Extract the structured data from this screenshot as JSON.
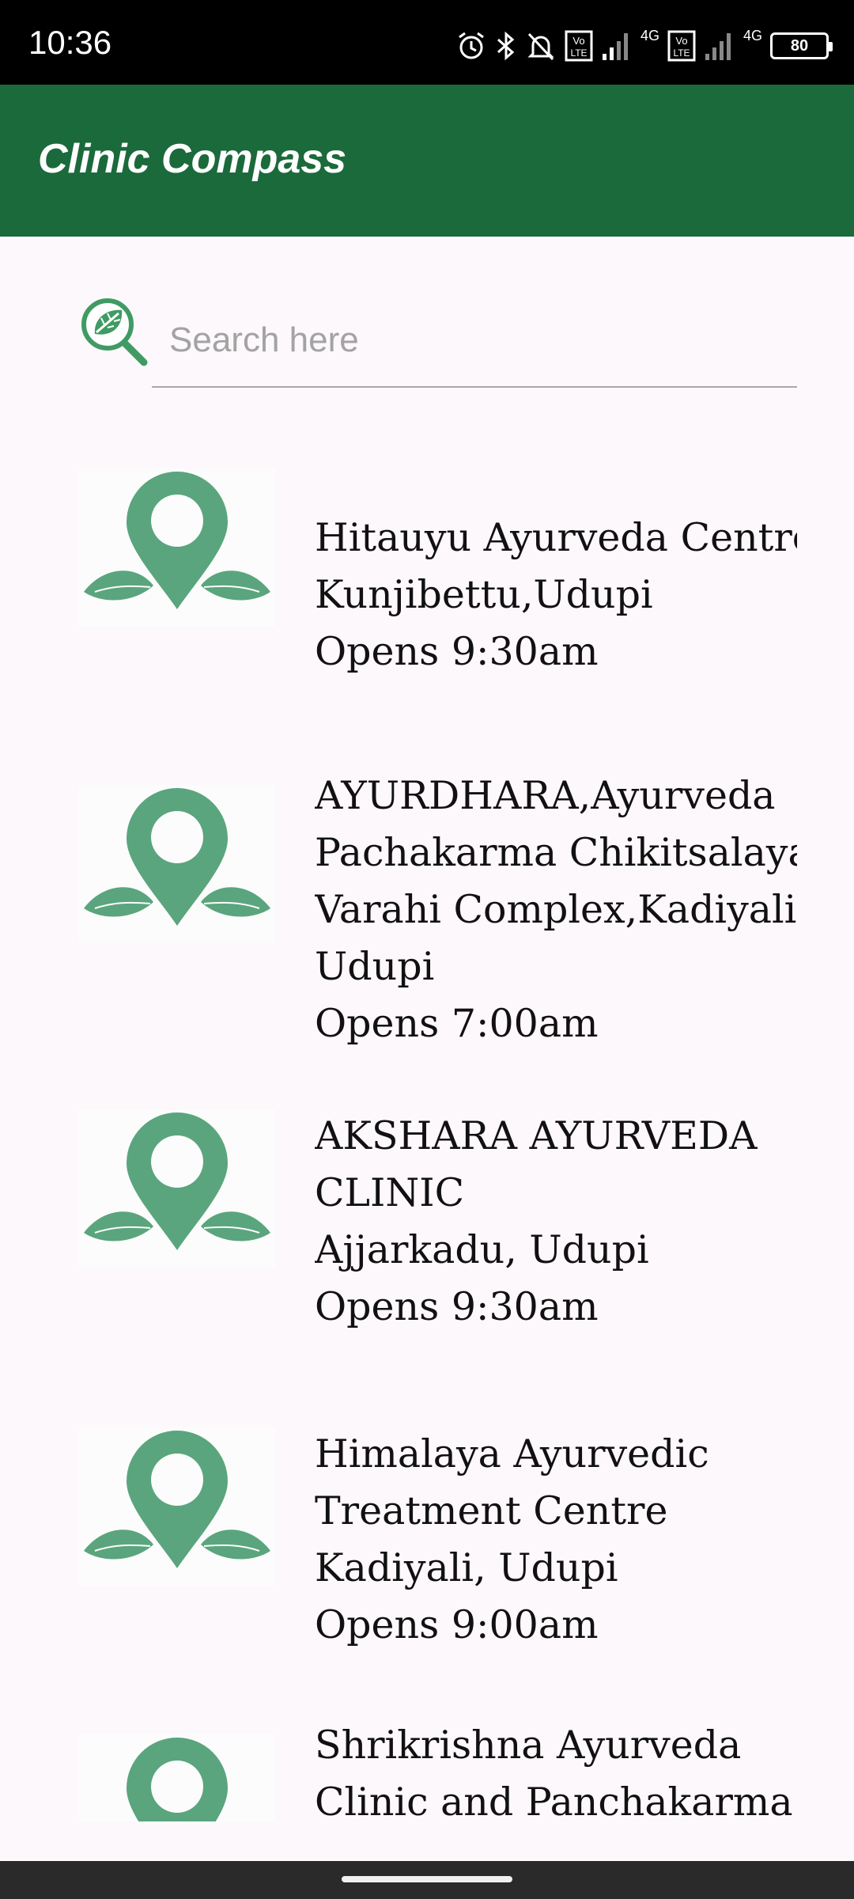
{
  "status_bar": {
    "time": "10:36",
    "battery": "80",
    "network_1": "4G",
    "network_2": "4G",
    "icons": [
      "alarm-icon",
      "bluetooth-icon",
      "bell-icon",
      "volte-icon",
      "signal-icon",
      "volte-icon",
      "signal-icon",
      "battery-icon"
    ]
  },
  "app_bar": {
    "title": "Clinic Compass"
  },
  "search": {
    "placeholder": "Search here"
  },
  "colors": {
    "app_bar": "#1b6a3b",
    "pin": "#5aa57d",
    "background": "#fdf8fb"
  },
  "clinics": [
    {
      "lines": [
        "Hitauyu Ayurveda Centre",
        "Kunjibettu,Udupi",
        "Opens 9:30am"
      ]
    },
    {
      "lines": [
        "AYURDHARA,Ayurveda",
        "Pachakarma Chikitsalaya",
        "Varahi Complex,Kadiyali",
        "Udupi",
        "Opens 7:00am"
      ]
    },
    {
      "lines": [
        "AKSHARA AYURVEDA",
        "CLINIC",
        "Ajjarkadu, Udupi",
        "Opens 9:30am"
      ]
    },
    {
      "lines": [
        "Himalaya Ayurvedic",
        "Treatment Centre",
        "Kadiyali, Udupi",
        "Opens 9:00am"
      ]
    },
    {
      "lines": [
        "Shrikrishna Ayurveda",
        "Clinic and Panchakarma"
      ]
    }
  ]
}
